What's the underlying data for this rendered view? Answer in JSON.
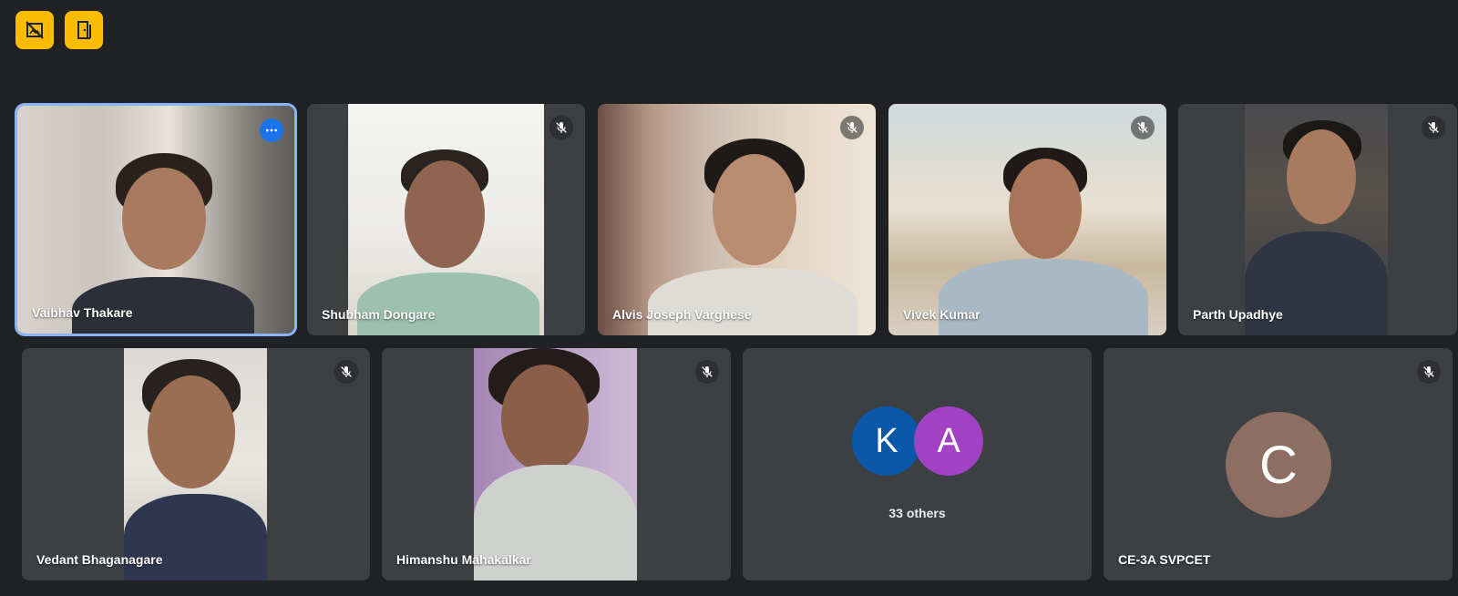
{
  "toolbar": {
    "buttons": [
      {
        "icon": "no-background-icon"
      },
      {
        "icon": "door-exit-icon"
      }
    ]
  },
  "participants": [
    {
      "name": "Vaibhav Thakare",
      "active": true,
      "muted": false
    },
    {
      "name": "Shubham Dongare",
      "muted": true
    },
    {
      "name": "Alvis Joseph Varghese",
      "muted": true
    },
    {
      "name": "Vivek Kumar",
      "muted": true
    },
    {
      "name": "Parth Upadhye",
      "muted": true
    },
    {
      "name": "Vedant Bhaganagare",
      "muted": true
    },
    {
      "name": "Himanshu Mahakalkar",
      "muted": true
    }
  ],
  "others": {
    "avatars": [
      {
        "letter": "K",
        "color": "#0b57a8"
      },
      {
        "letter": "A",
        "color": "#a142c4"
      }
    ],
    "label": "33 others"
  },
  "room_tile": {
    "letter": "C",
    "color": "#8d6e63",
    "name": "CE-3A SVPCET",
    "muted": true
  },
  "colors": {
    "background": "#202124",
    "tile": "#3c4043",
    "accent": "#fbbc04",
    "active_border": "#8ab4f8"
  }
}
